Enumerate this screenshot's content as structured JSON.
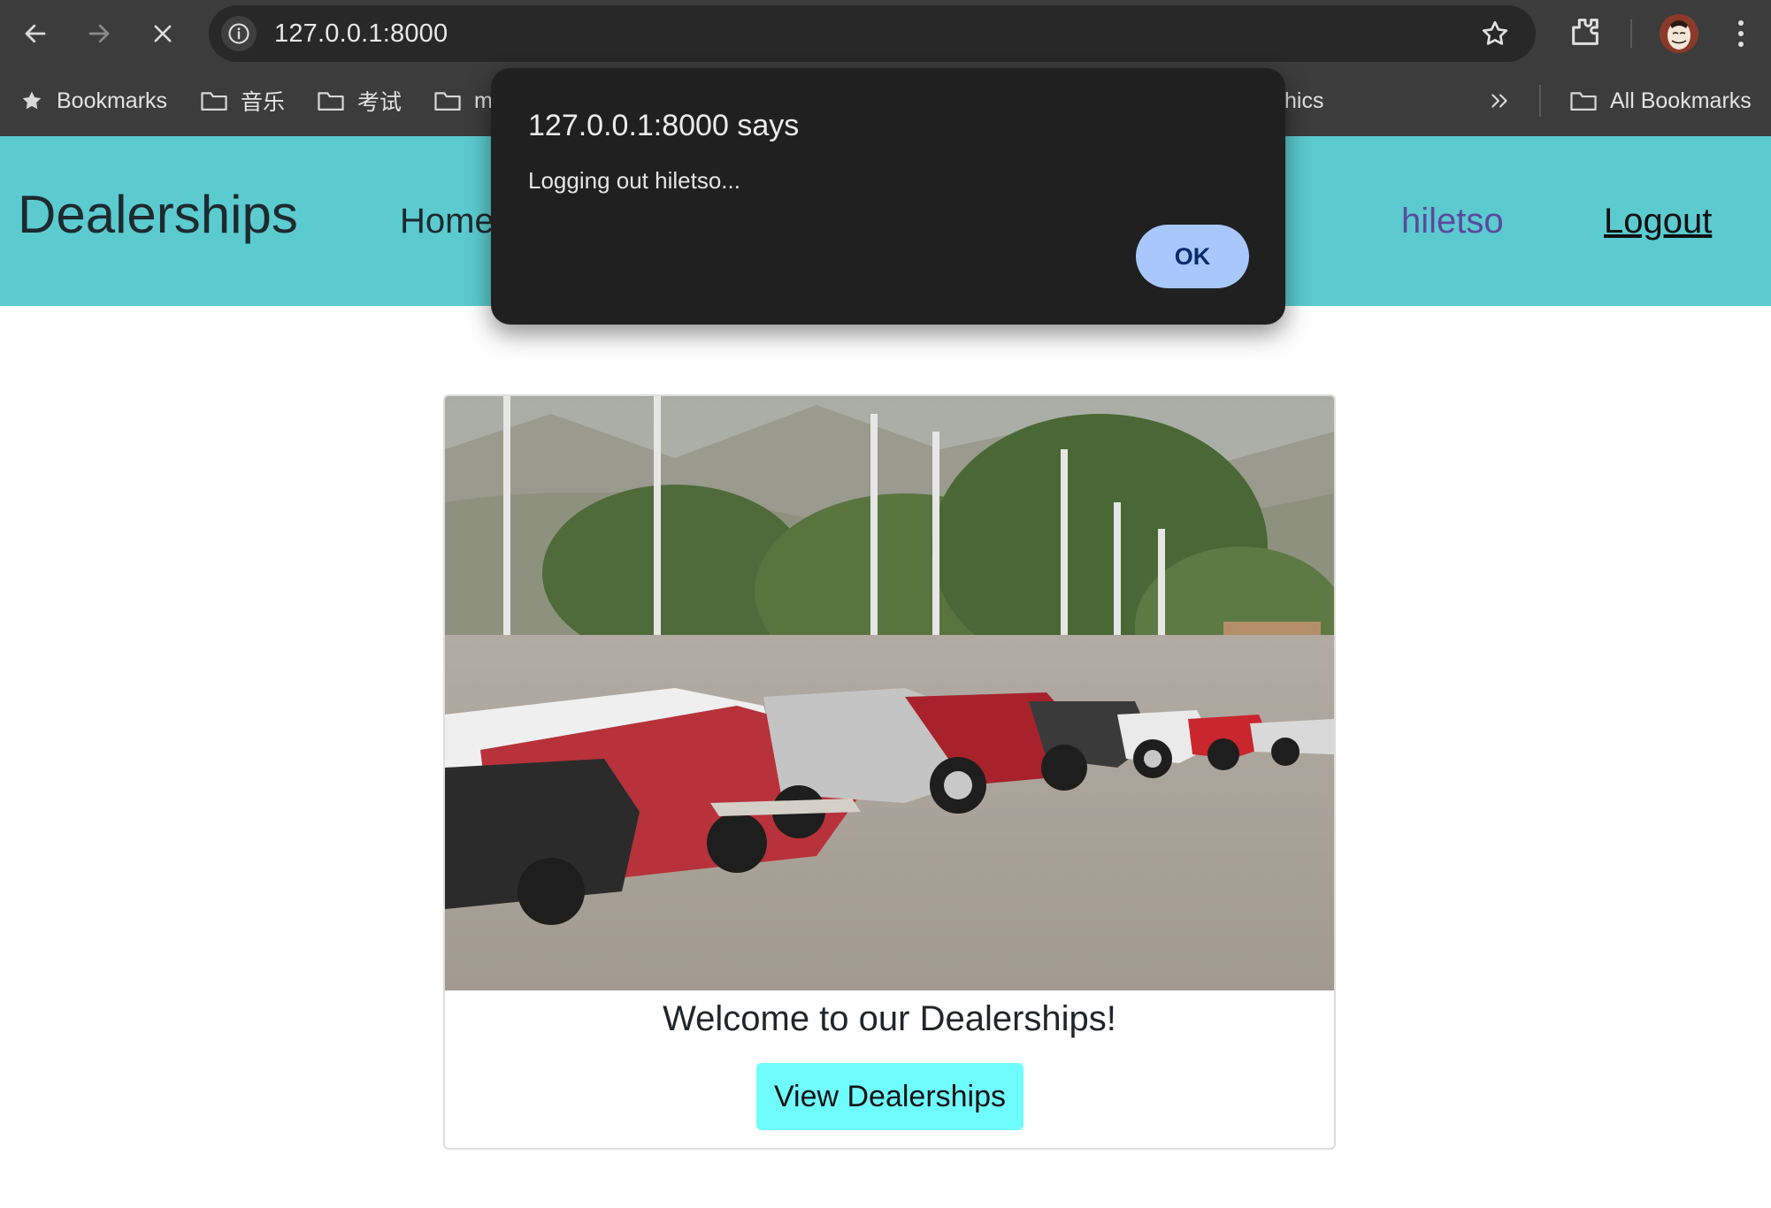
{
  "browser": {
    "url": "127.0.0.1:8000",
    "bookmarks": [
      {
        "label": "Bookmarks"
      },
      {
        "label": "音乐"
      },
      {
        "label": "考试"
      },
      {
        "label": "m"
      },
      {
        "label": "hics"
      }
    ],
    "all_bookmarks_label": "All Bookmarks",
    "icons": [
      "back-icon",
      "forward-icon",
      "stop-icon",
      "info-icon",
      "star-icon",
      "extensions-icon",
      "profile-avatar",
      "more-icon",
      "folder-icon",
      "chevrons-right-icon"
    ]
  },
  "navbar": {
    "brand": "Dealerships",
    "home": "Home",
    "username": "hiletso",
    "logout": "Logout",
    "background": "#5bcbd0"
  },
  "card": {
    "title": "Welcome to our Dealerships!",
    "button": "View Dealerships",
    "button_color": "#6ffcff"
  },
  "dialog": {
    "title": "127.0.0.1:8000 says",
    "message": "Logging out hiletso...",
    "ok": "OK"
  }
}
